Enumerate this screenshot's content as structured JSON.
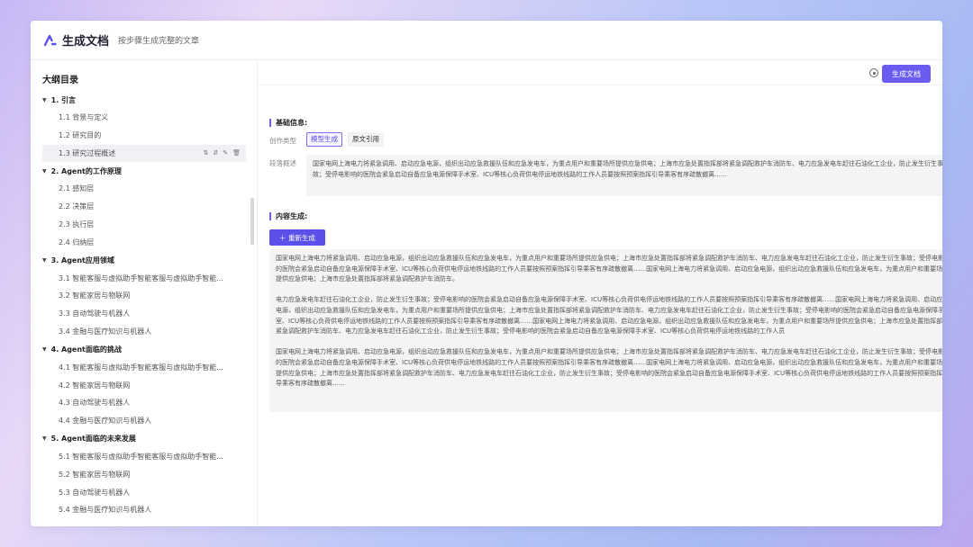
{
  "header": {
    "title": "生成文档",
    "subtitle": "按步骤生成完整的文章"
  },
  "sidebar": {
    "title": "大纲目录",
    "sections": [
      {
        "label": "1. 引言",
        "items": [
          "1.1 背景与定义",
          "1.2 研究目的",
          "1.3 研究过程概述"
        ]
      },
      {
        "label": "2. Agent的工作原理",
        "items": [
          "2.1 感知层",
          "2.2 决策层",
          "2.3 执行层",
          "2.4 归纳层"
        ]
      },
      {
        "label": "3. Agent应用领域",
        "items": [
          "3.1 智能客服与虚拟助手智能客服与虚拟助手智能...",
          "3.2 智能家居与物联网",
          "3.3 自动驾驶与机器人",
          "3.4 金融与医疗知识与机器人"
        ]
      },
      {
        "label": "4. Agent面临的挑战",
        "items": [
          "4.1 智能客服与虚拟助手智能客服与虚拟助手智能...",
          "4.2 智能家居与物联网",
          "4.3 自动驾驶与机器人",
          "4.4 金融与医疗知识与机器人"
        ]
      },
      {
        "label": "5. Agent面临的未来发展",
        "items": [
          "5.1 智能客服与虚拟助手智能客服与虚拟助手智能...",
          "5.2 智能家居与物联网",
          "5.3 自动驾驶与机器人",
          "5.4 金融与医疗知识与机器人"
        ]
      }
    ],
    "active_item": "1.3 研究过程概述",
    "item_actions": [
      "⇅",
      "⇵",
      "✎",
      "🗑"
    ]
  },
  "toolbar": {
    "generate_label": "生成文档"
  },
  "basic_info": {
    "label": "基础信息:",
    "type_label": "创作类型",
    "type_options": [
      "模型生成",
      "原文引用"
    ],
    "summary_label": "段落概述",
    "summary_text": "国家电网上海电力将紧急调用、启动应急电源，组织出动应急救援队伍和应急发电车，为重点用户和重要场所提供应急供电；上海市应急处置指挥部将紧急调配救护车消防车、电力应急发电车赶往石油化工企业，防止发生衍生事故；受停电影响的医院会紧急启动自备应急电源保障手术室、ICU等核心负荷供电停运地铁线路的工作人员要按照预案指挥引导乘客有序疏散撤离……"
  },
  "content": {
    "label": "内容生成:",
    "regenerate_label": "重新生成",
    "paragraphs": [
      "国家电网上海电力将紧急调用、启动应急电源，组织出动应急救援队伍和应急发电车，为重点用户和重要场所提供应急供电；上海市应急处置指挥部将紧急调配救护车消防车、电力应急发电车赶往石油化工企业，防止发生衍生事故；受停电影响的医院会紧急启动自备应急电源保障手术室、ICU等核心负荷供电停运地铁线路的工作人员要按照预案指挥引导乘客有序疏散撤离……国家电网上海电力将紧急调用、启动应急电源，组织出动应急救援队伍和应急发电车，为重点用户和重要场所提供应急供电；上海市应急处置指挥部将紧急调配救护车消防车。",
      "电力应急发电车赶往石油化工企业，防止发生衍生事故；受停电影响的医院会紧急启动自备应急电源保障手术室、ICU等核心负荷供电停运地铁线路的工作人员要按照预案指挥引导乘客有序疏散撤离……国家电网上海电力将紧急调用、启动应急电源，组织出动应急救援队伍和应急发电车，为重点用户和重要场所提供应急供电；上海市应急处置指挥部将紧急调配救护车消防车、电力应急发电车赶往石油化工企业，防止发生衍生事故；受停电影响的医院会紧急启动自备应急电源保障手术室、ICU等核心负荷供电停运地铁线路的工作人员要按照预案指挥引导乘客有序疏散撤离……国家电网上海电力将紧急调用、启动应急电源，组织出动应急救援队伍和应急发电车，为重点用户和重要场所提供应急供电；上海市应急处置指挥部将紧急调配救护车消防车、电力应急发电车赶往石油化工企业，防止发生衍生事故；受停电影响的医院会紧急启动自备应急电源保障手术室、ICU等核心负荷供电停运地铁线路的工作人员",
      "国家电网上海电力将紧急调用、启动应急电源，组织出动应急救援队伍和应急发电车，为重点用户和重要场所提供应急供电；上海市应急处置指挥部将紧急调配救护车消防车、电力应急发电车赶往石油化工企业，防止发生衍生事故；受停电影响的医院会紧急启动自备应急电源保障手术室、ICU等核心负荷供电停运地铁线路的工作人员要按照预案指挥引导乘客有序疏散撤离……国家电网上海电力将紧急调用、启动应急电源，组织出动应急救援队伍和应急发电车，为重点用户和重要场所提供应急供电；上海市应急处置指挥部将紧急调配救护车消防车、电力应急发电车赶往石油化工企业，防止发生衍生事故；受停电影响的医院会紧急启动自备应急电源保障手术室、ICU等核心负荷供电停运地铁线路的工作人员要按照预案指挥引导乘客有序疏散撤离……"
    ]
  }
}
